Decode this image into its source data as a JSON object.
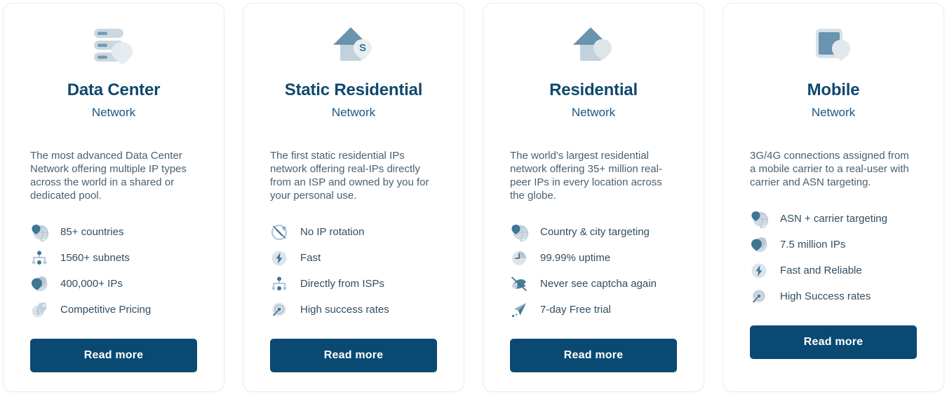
{
  "theme": {
    "title_color": "#10496e",
    "subtitle_color": "#18587f",
    "body_color": "#4a6070",
    "feature_color": "#2f4e63",
    "button_bg": "#0a4a72",
    "button_text_color": "#ffffff",
    "card_border": "#ececec",
    "icon_dark": "#5f8fae",
    "icon_light": "#dde4e9"
  },
  "cards": [
    {
      "icon": "server-rack-pin-icon",
      "title": "Data Center",
      "subtitle": "Network",
      "description": "The most advanced Data Center Network offering multiple IP types across the world in a shared or dedicated pool.",
      "features": [
        {
          "icon": "globe-pin-icon",
          "label": "85+ countries"
        },
        {
          "icon": "network-nodes-icon",
          "label": "1560+ subnets"
        },
        {
          "icon": "location-pin-icon",
          "label": "400,000+ IPs"
        },
        {
          "icon": "price-tag-dollar-icon",
          "label": "Competitive Pricing"
        }
      ],
      "button_label": "Read more"
    },
    {
      "icon": "house-static-pin-icon",
      "title": "Static Residential",
      "subtitle": "Network",
      "description": "The first static residential IPs network offering real-IPs directly from an ISP and owned by you for your personal use.",
      "features": [
        {
          "icon": "no-rotation-icon",
          "label": "No IP rotation"
        },
        {
          "icon": "lightning-bolt-icon",
          "label": "Fast"
        },
        {
          "icon": "network-nodes-icon",
          "label": "Directly from ISPs"
        },
        {
          "icon": "target-arrow-icon",
          "label": "High success rates"
        }
      ],
      "button_label": "Read more"
    },
    {
      "icon": "house-pin-icon",
      "title": "Residential",
      "subtitle": "Network",
      "description": "The world's largest residential network offering 35+ million real-peer IPs in every location across the globe.",
      "features": [
        {
          "icon": "globe-pin-icon",
          "label": "Country & city targeting"
        },
        {
          "icon": "clock-icon",
          "label": "99.99% uptime"
        },
        {
          "icon": "no-captcha-icon",
          "label": "Never see captcha again"
        },
        {
          "icon": "paper-plane-icon",
          "label": "7-day Free trial"
        }
      ],
      "button_label": "Read more"
    },
    {
      "icon": "tablet-pin-icon",
      "title": "Mobile",
      "subtitle": "Network",
      "description": "3G/4G connections assigned from a mobile carrier to a real-user with carrier and ASN targeting.",
      "features": [
        {
          "icon": "globe-pin-icon",
          "label": "ASN + carrier targeting"
        },
        {
          "icon": "location-pin-icon",
          "label": "7.5 million IPs"
        },
        {
          "icon": "lightning-bolt-icon",
          "label": "Fast and Reliable"
        },
        {
          "icon": "target-arrow-icon",
          "label": "High Success rates"
        }
      ],
      "button_label": "Read more"
    }
  ]
}
